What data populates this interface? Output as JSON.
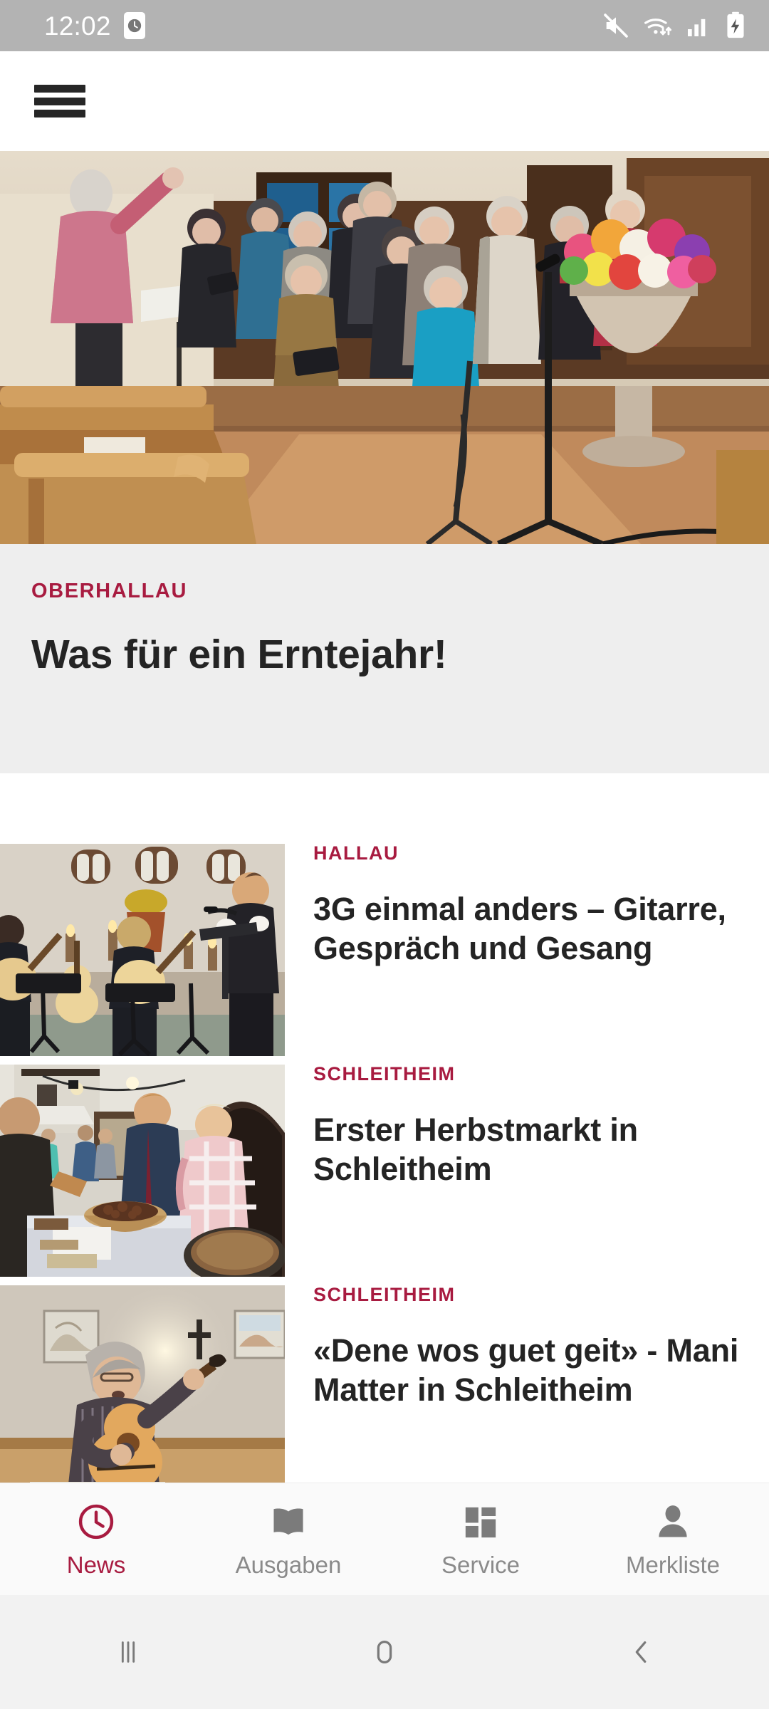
{
  "status_bar": {
    "time": "12:02",
    "alarm_icon": "alarm-clock-icon",
    "icons": [
      "mute-icon",
      "wifi-icon",
      "cellular-signal-icon",
      "battery-charging-icon"
    ]
  },
  "app_bar": {
    "menu_icon": "hamburger-menu-icon"
  },
  "featured": {
    "image_alt": "church-choir-photo",
    "kicker": "OBERHALLAU",
    "title": "Was für ein Erntejahr!"
  },
  "articles": [
    {
      "image_alt": "guitar-concert-church-photo",
      "kicker": "HALLAU",
      "title": "3G einmal anders – Gitarre, Gespräch und Gesang"
    },
    {
      "image_alt": "autumn-market-photo",
      "kicker": "SCHLEITHEIM",
      "title": "Erster Herbstmarkt in Schleitheim"
    },
    {
      "image_alt": "guitar-singer-photo",
      "kicker": "SCHLEITHEIM",
      "title": "«Dene wos guet geit» - Mani Matter in Schleitheim"
    }
  ],
  "tab_bar": {
    "tabs": [
      {
        "label": "News",
        "icon": "clock-icon",
        "active": true
      },
      {
        "label": "Ausgaben",
        "icon": "book-icon",
        "active": false
      },
      {
        "label": "Service",
        "icon": "dashboard-grid-icon",
        "active": false
      },
      {
        "label": "Merkliste",
        "icon": "person-icon",
        "active": false
      }
    ]
  },
  "system_nav": {
    "buttons": [
      "recents-icon",
      "home-icon",
      "back-icon"
    ]
  },
  "colors": {
    "accent": "#a81b40",
    "text": "#242424",
    "muted": "#8a8a8a",
    "card_bg": "#eeeeee",
    "status_bg": "#b3b3b3",
    "tabbar_bg": "#fafafa",
    "navbar_bg": "#f2f2f2"
  }
}
